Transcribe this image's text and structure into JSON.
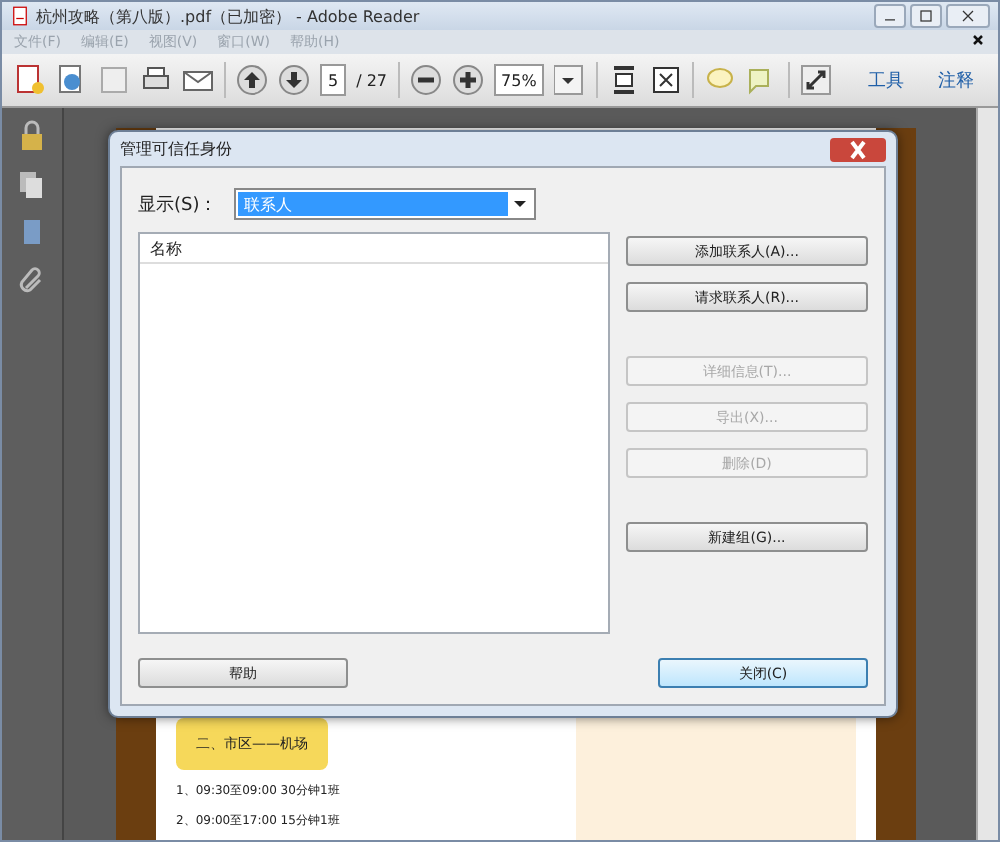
{
  "window": {
    "title": "杭州攻略（第八版）.pdf（已加密） - Adobe Reader"
  },
  "menu": [
    {
      "label": "文件(F)"
    },
    {
      "label": "编辑(E)"
    },
    {
      "label": "视图(V)"
    },
    {
      "label": "窗口(W)"
    },
    {
      "label": "帮助(H)"
    }
  ],
  "toolbar": {
    "page": "5",
    "page_total": "/ 27",
    "zoom": "75%",
    "panes": [
      {
        "label": "工具"
      },
      {
        "label": "注释"
      }
    ]
  },
  "document": {
    "heading": "二、市区——机场",
    "lines": [
      "1、09:30至09:00  30分钟1班",
      "2、09:00至17:00  15分钟1班"
    ]
  },
  "dialog": {
    "title": "管理可信任身份",
    "show_label": "显示(S)：",
    "show_value": "联系人",
    "list_header": "名称",
    "button_groups": [
      [
        {
          "label": "添加联系人(A)...",
          "disabled": false
        },
        {
          "label": "请求联系人(R)...",
          "disabled": false
        }
      ],
      [
        {
          "label": "详细信息(T)...",
          "disabled": true
        },
        {
          "label": "导出(X)...",
          "disabled": true
        },
        {
          "label": "删除(D)",
          "disabled": true
        }
      ],
      [
        {
          "label": "新建组(G)...",
          "disabled": false
        }
      ]
    ],
    "help_button": {
      "label": "帮助",
      "default": false
    },
    "close_button": {
      "label": "关闭(C)",
      "default": true
    }
  }
}
